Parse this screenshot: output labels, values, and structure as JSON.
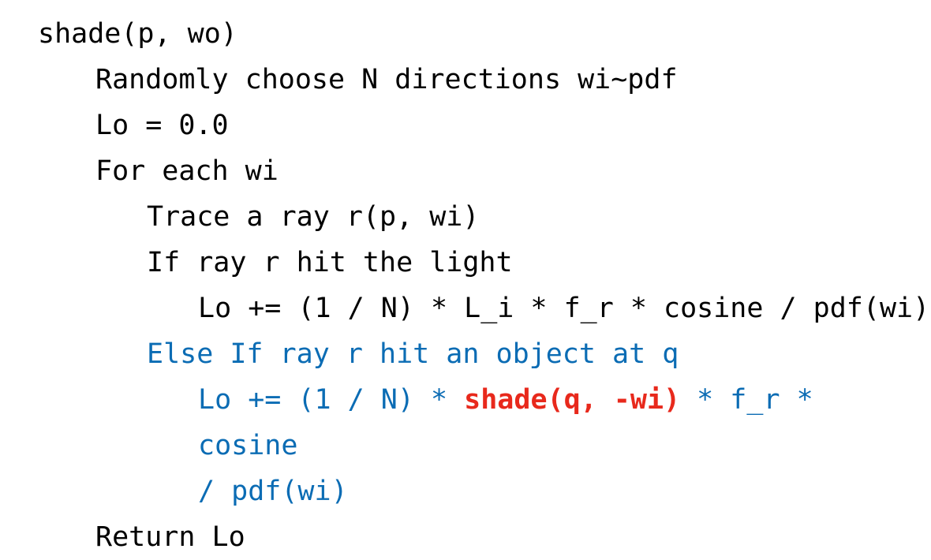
{
  "slide": {
    "background_color": "#ffffff",
    "default_text_color": "#000000",
    "accent_blue": "#0b6cb4",
    "accent_red": "#e8291c"
  },
  "code": {
    "lines": [
      {
        "indent": 0,
        "text": "shade(p, wo)",
        "color": "#000000"
      },
      {
        "indent": 1,
        "text": "Randomly choose N directions wi~pdf",
        "color": "#000000"
      },
      {
        "indent": 1,
        "text": "Lo = 0.0",
        "color": "#000000"
      },
      {
        "indent": 1,
        "text": "For each wi",
        "color": "#000000"
      },
      {
        "indent": 2,
        "text": "Trace a ray r(p, wi)",
        "color": "#000000"
      },
      {
        "indent": 2,
        "text": "If ray r hit the light",
        "color": "#000000"
      },
      {
        "indent": 3,
        "text": "Lo += (1 / N) * L_i * f_r * cosine / pdf(wi)",
        "color": "#000000"
      },
      {
        "indent": 2,
        "text": "Else If ray r hit an object at q",
        "color": "#0b6cb4"
      },
      {
        "indent": 3,
        "text": "Lo += (1 / N) * shade(q, -wi) * f_r * cosine / pdf(wi)",
        "color": "#0b6cb4"
      },
      {
        "indent": 1,
        "text": "Return Lo",
        "color": "#000000"
      }
    ],
    "line_1_label": "shade(p, wo)",
    "line_2_label": "Randomly choose N directions wi~pdf",
    "line_3_label": "Lo = 0.0",
    "line_4_label": "For each wi",
    "line_5_label": "Trace a ray r(p, wi)",
    "line_6_label": "If ray r hit the light",
    "line_7_label": "Lo += (1 / N) * L_i * f_r * cosine / pdf(wi)",
    "line_8_label": "Else If ray r hit an object at q",
    "line_9_part1": "Lo += (1 / N) * ",
    "line_9_part2_red": "shade(q, -wi)",
    "line_9_part3": " * f_r * cosine",
    "line_9_part4": "/ pdf(wi)",
    "line_10_label": "Return Lo"
  }
}
